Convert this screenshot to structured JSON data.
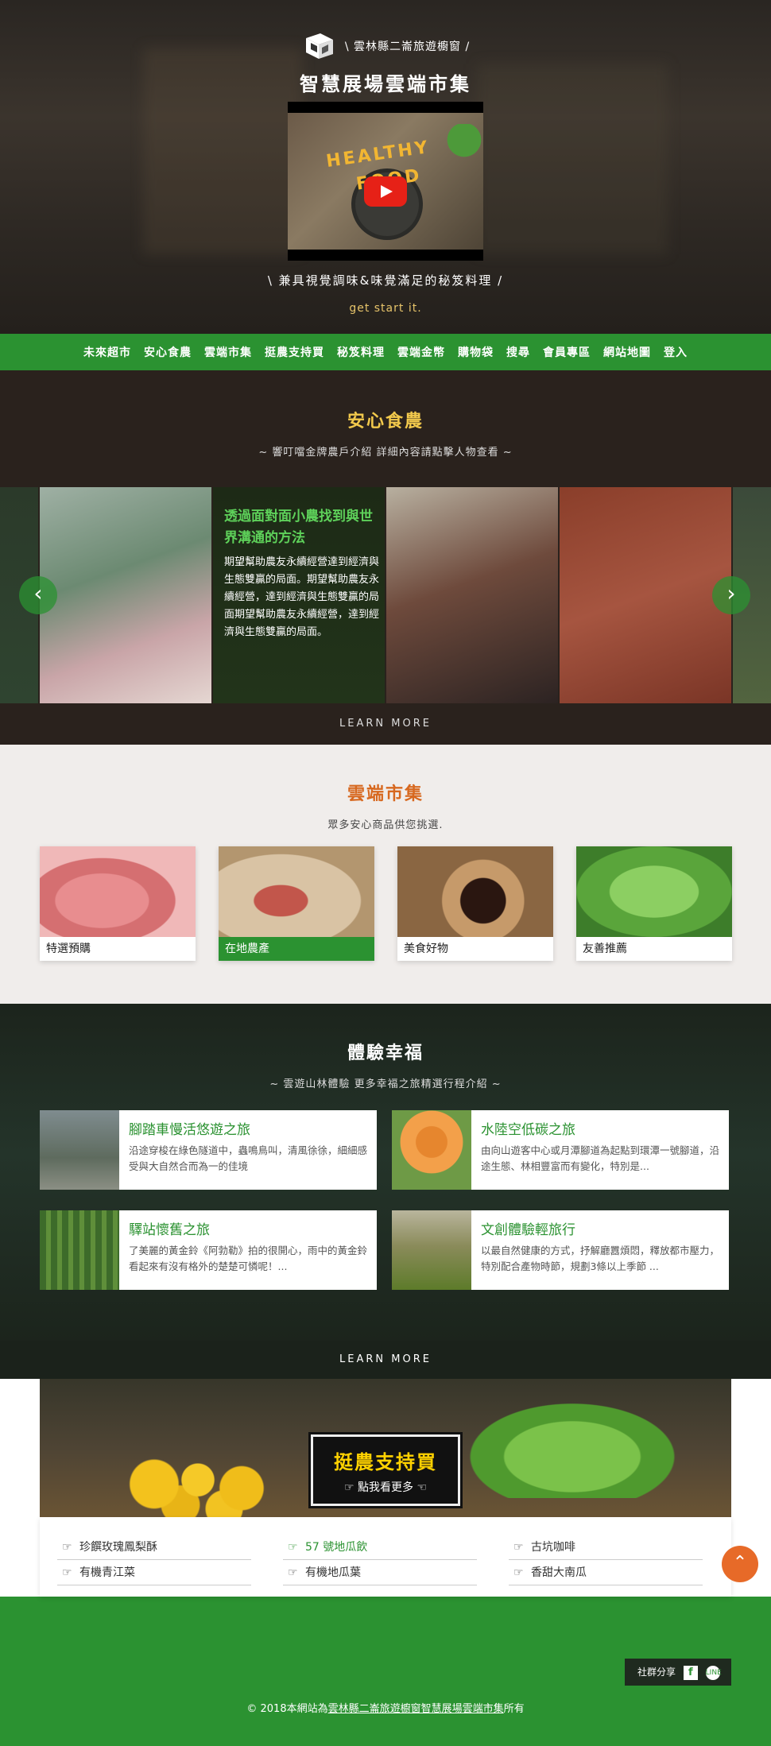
{
  "hero": {
    "subtitle": "\\ 雲林縣二崙旅遊櫥窗 /",
    "title": "智慧展場雲端市集",
    "video_text_1": "HEALTHY",
    "video_text_2": "FOOD",
    "tagline": "\\ 兼具視覺調味&味覺滿足的秘笈料理 /",
    "cta": "get start it."
  },
  "nav": {
    "items": [
      "未來超市",
      "安心食農",
      "雲端市集",
      "挺農支持買",
      "秘笈料理",
      "雲端金幣",
      "購物袋",
      "搜尋",
      "會員專區",
      "網站地圖",
      "登入"
    ]
  },
  "safe": {
    "title": "安心食農",
    "subtitle": "~ 響叮噹金牌農戶介紹 詳細內容請點擊人物查看 ~",
    "card_title": "透過面對面小農找到與世界溝通的方法",
    "card_body": "期望幫助農友永續經營達到經濟與生態雙贏的局面。期望幫助農友永續經營，達到經濟與生態雙贏的局面期望幫助農友永續經營，達到經濟與生態雙贏的局面。",
    "prev": "‹",
    "next": "›",
    "learn_more": "LEARN MORE"
  },
  "cloud": {
    "title": "雲端市集",
    "subtitle": "眾多安心商品供您挑選.",
    "products": [
      {
        "label": "特選預購"
      },
      {
        "label": "在地農產"
      },
      {
        "label": "美食好物"
      },
      {
        "label": "友善推薦"
      }
    ]
  },
  "happy": {
    "title": "體驗幸福",
    "subtitle": "~ 雲遊山林體驗 更多幸福之旅精選行程介紹 ~",
    "items": [
      {
        "title": "腳踏車慢活悠遊之旅",
        "desc": "沿途穿梭在綠色隧道中，蟲鳴鳥叫，清風徐徐，細細感受與大自然合而為一的佳境"
      },
      {
        "title": "水陸空低碳之旅",
        "desc": "由向山遊客中心或月潭腳道為起點到環潭一號腳道，沿途生態、林相豐富而有變化，特別是..."
      },
      {
        "title": "驛站懷舊之旅",
        "desc": "了美麗的黃金鈴《阿勃勒》拍的很開心，雨中的黃金鈴看起來有沒有格外的楚楚可憐呢！..."
      },
      {
        "title": "文創體驗輕旅行",
        "desc": "以最自然健康的方式，抒解廳囂煩悶，釋放都市壓力，特別配合產物時節，規劃3條以上季節 ..."
      }
    ],
    "learn_more": "LEARN MORE"
  },
  "support": {
    "sign_title": "挺農支持買",
    "sign_sub": "點我看更多",
    "columns": [
      [
        "珍饌玫瑰鳳梨酥",
        "有機青江菜"
      ],
      [
        "57 號地瓜飲",
        "有機地瓜葉"
      ],
      [
        "古坑咖啡",
        "香甜大南瓜"
      ]
    ],
    "to_top": "⌃"
  },
  "footer": {
    "share_label": "社群分享",
    "fb": "f",
    "line": "LINE",
    "copy_prefix": "© 2018本網站為",
    "copy_link": "雲林縣二崙旅遊櫥窗智慧展場雲端市集",
    "copy_suffix": "所有"
  }
}
